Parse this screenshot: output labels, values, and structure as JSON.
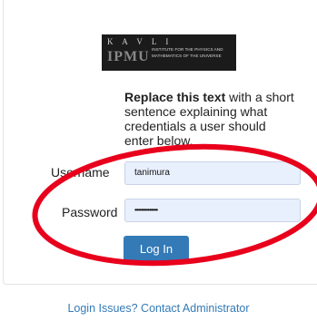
{
  "logo": {
    "letters": "K A V L I",
    "mark": "IPMU",
    "line1": "INSTITUTE FOR THE PHYSICS AND",
    "line2": "MATHEMATICS OF THE UNIVERSE"
  },
  "intro": {
    "bold": "Replace this text",
    "rest": " with a short sentence explaining what credentials a user should enter below."
  },
  "form": {
    "username_label": "Username",
    "username_value": "tanimura",
    "password_label": "Password",
    "password_value": "••••••••••••••",
    "login_label": "Log In"
  },
  "footer": {
    "link": "Login Issues? Contact Administrator"
  },
  "annotation": {
    "color": "#e8001c",
    "shape": "ellipse"
  }
}
